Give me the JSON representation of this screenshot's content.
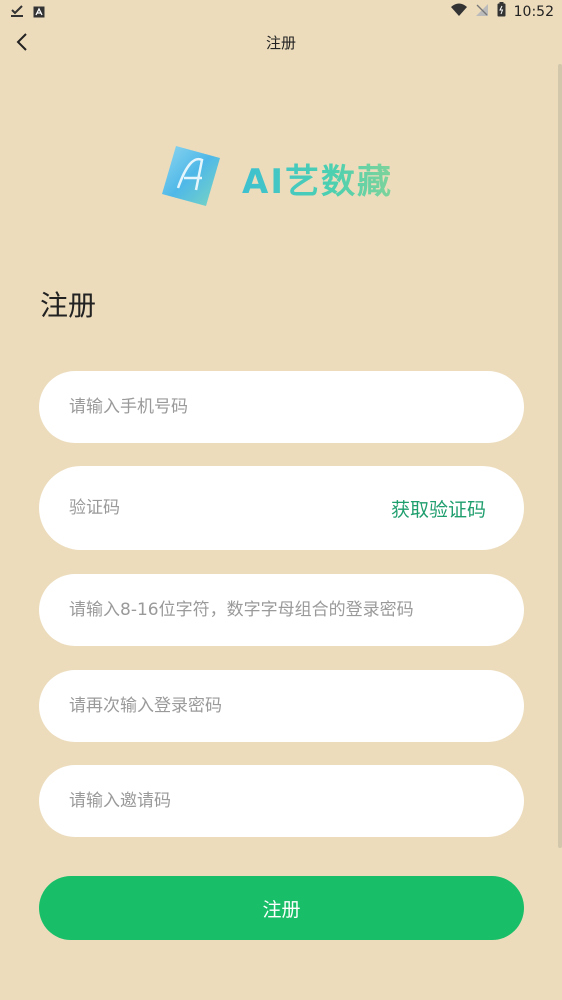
{
  "status_bar": {
    "time": "10:52"
  },
  "nav": {
    "title": "注册"
  },
  "logo": {
    "text": "AI艺数藏"
  },
  "page_heading": "注册",
  "form": {
    "phone_placeholder": "请输入手机号码",
    "phone_value": "",
    "code_placeholder": "验证码",
    "code_value": "",
    "get_code_label": "获取验证码",
    "password_placeholder": "请输入8-16位字符，数字字母组合的登录密码",
    "password_value": "",
    "confirm_password_placeholder": "请再次输入登录密码",
    "confirm_password_value": "",
    "invite_placeholder": "请输入邀请码",
    "invite_value": ""
  },
  "submit_label": "注册",
  "colors": {
    "background": "#ecdcbc",
    "accent": "#19bf68",
    "link": "#1f9e6e"
  }
}
